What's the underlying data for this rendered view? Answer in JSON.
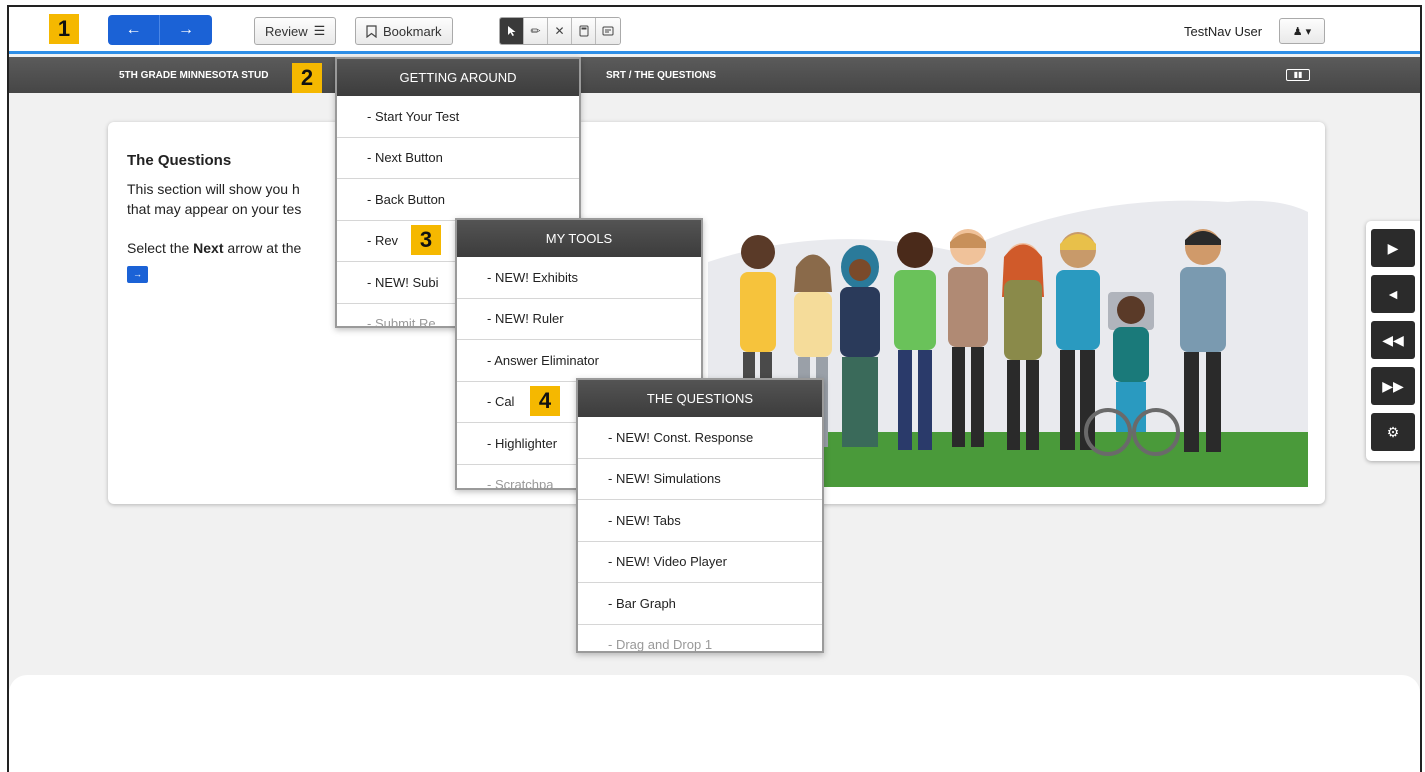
{
  "toolbar": {
    "back_icon": "arrow-left-icon",
    "forward_icon": "arrow-right-icon",
    "review_label": "Review",
    "bookmark_label": "Bookmark",
    "tools": [
      "pointer-icon",
      "pencil-icon",
      "eliminator-icon",
      "calculator-icon",
      "notepad-icon"
    ],
    "user_name": "TestNav User",
    "accent": "#1b62d6"
  },
  "badges": [
    "1",
    "2",
    "3",
    "4"
  ],
  "breadcrumb": {
    "left": "5TH GRADE MINNESOTA STUD",
    "right": "SRT  /  THE QUESTIONS"
  },
  "content": {
    "title": "The Questions",
    "line1": "This section will show you h",
    "line2": "that may appear on your tes",
    "select_prefix": "Select the ",
    "select_bold": "Next",
    "select_suffix": " arrow at the"
  },
  "menus": {
    "getting_around": {
      "header": "GETTING AROUND",
      "items": [
        "- Start Your Test",
        "- Next Button",
        "- Back Button",
        "- Rev",
        "- NEW! Subi",
        "- Submit Re"
      ]
    },
    "my_tools": {
      "header": "MY TOOLS",
      "items": [
        "- NEW! Exhibits",
        "- NEW! Ruler",
        "- Answer Eliminator",
        "- Cal",
        "- Highlighter",
        "- Scratchpa"
      ]
    },
    "the_questions": {
      "header": "THE QUESTIONS",
      "items": [
        "- NEW! Const. Response",
        "- NEW! Simulations",
        "- NEW! Tabs",
        "- NEW! Video Player",
        "- Bar Graph",
        "- Drag and Drop 1"
      ]
    }
  },
  "side_panel": [
    "play-icon",
    "megaphone-icon",
    "rewind-icon",
    "fast-forward-icon",
    "gear-icon"
  ]
}
